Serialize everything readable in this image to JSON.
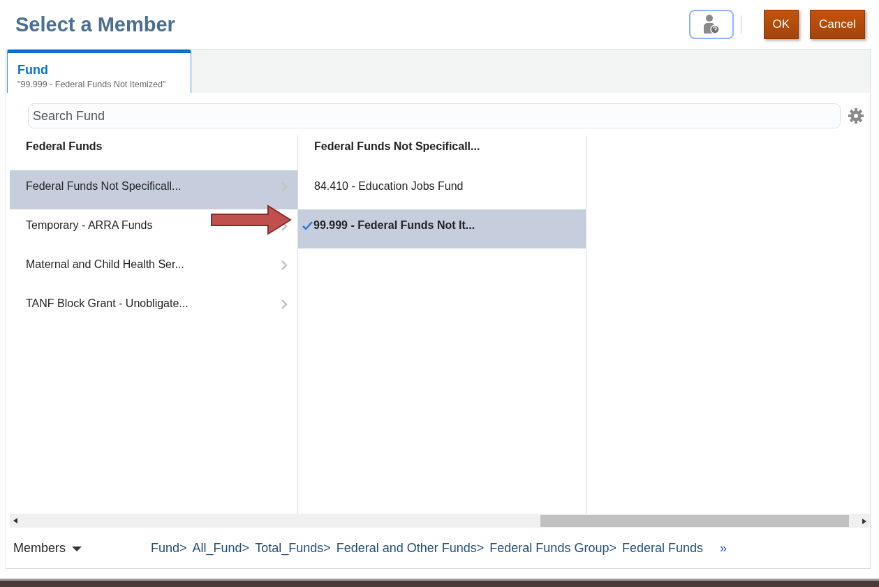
{
  "window": {
    "title": "Select a Member"
  },
  "buttons": [
    {
      "label": "OK",
      "kind": "primary"
    },
    {
      "label": "Cancel",
      "kind": "primary"
    }
  ],
  "tabs": [
    {
      "label": "Fund",
      "value": "\"99.999 - Federal Funds Not Itemized\"",
      "selected": true
    }
  ],
  "search": {
    "placeholder": "Search Fund"
  },
  "columns": [
    {
      "heading": "Federal Funds",
      "items": [
        {
          "label": "Federal Funds Not Specificall...",
          "selected": true,
          "checked": false,
          "has_children": true
        },
        {
          "label": "Temporary - ARRA Funds",
          "selected": false,
          "checked": false,
          "has_children": true
        },
        {
          "label": "Maternal and Child Health Ser...",
          "selected": false,
          "checked": false,
          "has_children": true
        },
        {
          "label": "TANF Block Grant - Unobligate...",
          "selected": false,
          "checked": false,
          "has_children": true
        }
      ]
    },
    {
      "heading": "Federal Funds Not Specificall...",
      "items": [
        {
          "label": "84.410 - Education Jobs Fund",
          "selected": false,
          "checked": false,
          "has_children": false
        },
        {
          "label": "99.999 - Federal Funds Not It...",
          "selected": true,
          "checked": true,
          "has_children": false
        }
      ]
    }
  ],
  "footer": {
    "members_label": "Members",
    "breadcrumb": [
      "Fund>",
      "All_Fund>",
      "Total_Funds>",
      "Federal and Other Funds>",
      "Federal Funds Group>",
      "Federal Funds"
    ],
    "more": "»"
  }
}
